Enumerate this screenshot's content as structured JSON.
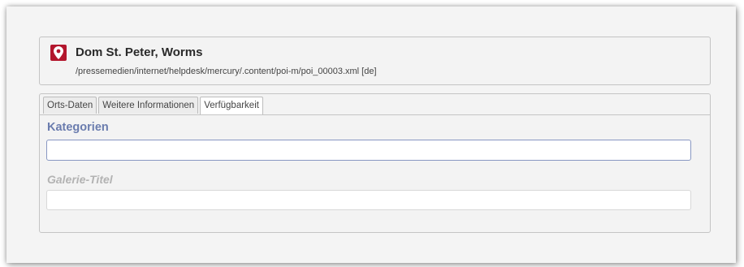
{
  "header": {
    "icon": "map-marker-icon",
    "icon_color": "#b3162d",
    "title": "Dom St. Peter, Worms",
    "path": "/pressemedien/internet/helpdesk/mercury/.content/poi-m/poi_00003.xml [de]"
  },
  "tabs": [
    {
      "label": "Orts-Daten",
      "active": false
    },
    {
      "label": "Weitere Informationen",
      "active": false
    },
    {
      "label": "Verfügbarkeit",
      "active": true
    }
  ],
  "fields": {
    "kategorien": {
      "label": "Kategorien",
      "value": "",
      "placeholder": ""
    },
    "galerie_titel": {
      "label": "Galerie-Titel",
      "value": "",
      "placeholder": ""
    }
  },
  "colors": {
    "label_active": "#6a7cae",
    "label_disabled": "#b3b3b3"
  }
}
